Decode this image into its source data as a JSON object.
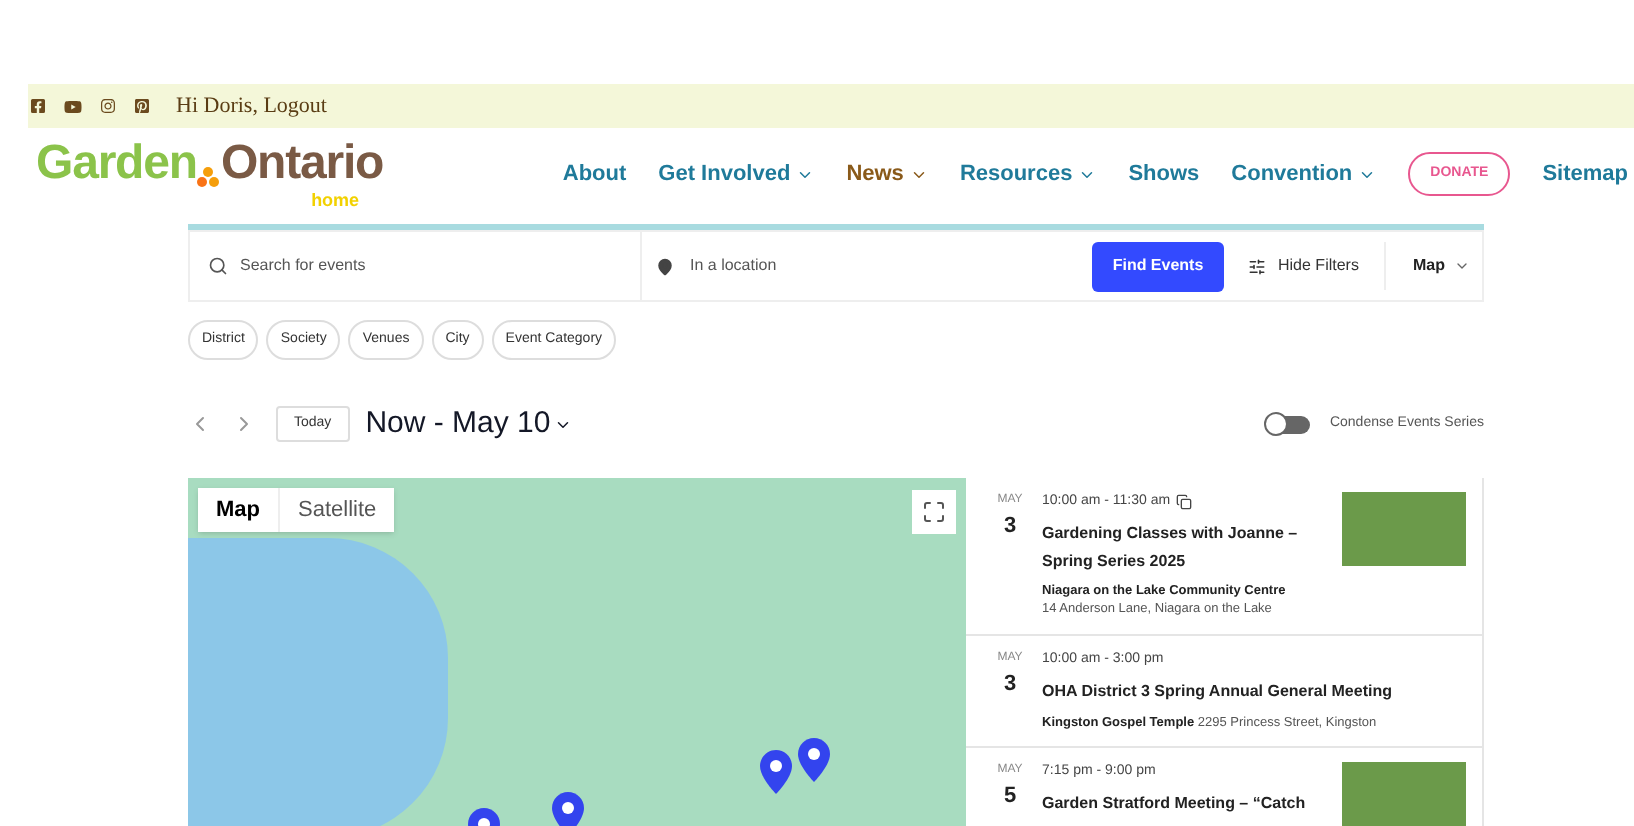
{
  "top_bar": {
    "greeting": "Hi Doris, Logout"
  },
  "logo": {
    "word1": "Garden",
    "word2": "Ontario",
    "tagline": "home"
  },
  "nav": [
    {
      "label": "About",
      "dropdown": false,
      "selected": false
    },
    {
      "label": "Get Involved",
      "dropdown": true,
      "selected": false
    },
    {
      "label": "News",
      "dropdown": true,
      "selected": true
    },
    {
      "label": "Resources",
      "dropdown": true,
      "selected": false
    },
    {
      "label": "Shows",
      "dropdown": false,
      "selected": false
    },
    {
      "label": "Convention",
      "dropdown": true,
      "selected": false
    }
  ],
  "donate_button": "DONATE",
  "sitemap_link": "Sitemap",
  "search": {
    "keyword_placeholder": "Search for events",
    "location_placeholder": "In a location",
    "find_button": "Find Events",
    "filters_button": "Hide Filters",
    "view_select": "Map"
  },
  "filters": [
    "District",
    "Society",
    "Venues",
    "City",
    "Event Category"
  ],
  "date_bar": {
    "today_button": "Today",
    "range": "Now - May 10",
    "condense_label": "Condense Events Series",
    "condense_on": false
  },
  "map": {
    "tabs": [
      {
        "label": "Map",
        "selected": true
      },
      {
        "label": "Satellite",
        "selected": false
      }
    ]
  },
  "events": [
    {
      "month": "MAY",
      "day": "3",
      "time": "10:00 am - 11:30 am",
      "recurring": true,
      "title": "Gardening Classes with Joanne – Spring Series 2025",
      "venue": "Niagara on the Lake Community Centre",
      "address": "14 Anderson Lane, Niagara on the Lake",
      "photo": true,
      "venue_inline": false
    },
    {
      "month": "MAY",
      "day": "3",
      "time": "10:00 am - 3:00 pm",
      "recurring": false,
      "title": "OHA District 3 Spring Annual General Meeting",
      "venue": "Kingston Gospel Temple",
      "address": "2295 Princess Street, Kingston",
      "photo": false,
      "venue_inline": true
    },
    {
      "month": "MAY",
      "day": "5",
      "time": "7:15 pm - 9:00 pm",
      "recurring": false,
      "title": "Garden Stratford Meeting – “Catch",
      "photo": true
    }
  ]
}
